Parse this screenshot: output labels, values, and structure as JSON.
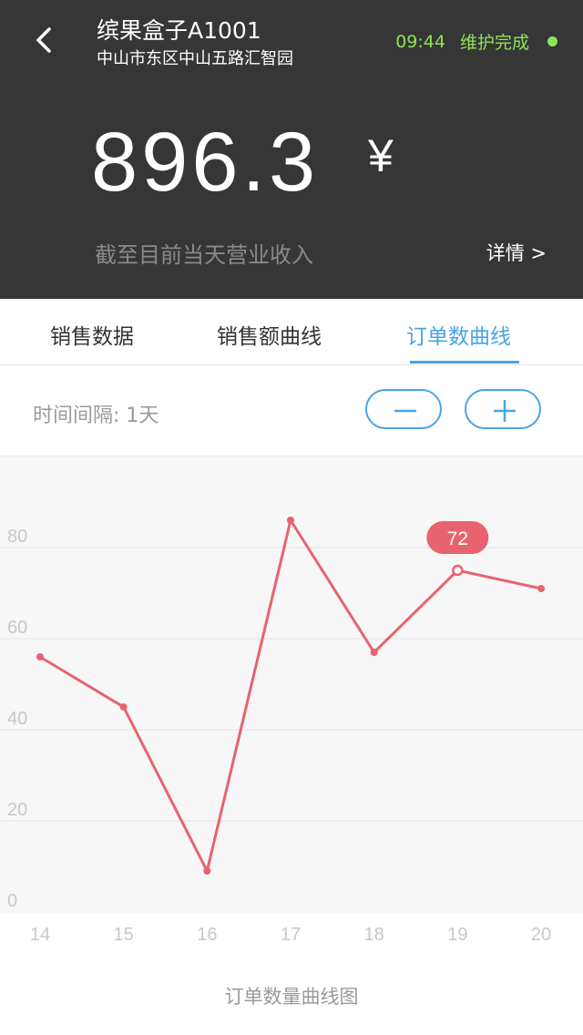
{
  "header": {
    "title": "缤果盒子A1001",
    "address": "中山市东区中山五路汇智园",
    "time": "09:44",
    "status_text": "维护完成",
    "status_color": "#8fe35a",
    "back_icon": "chevron-left-icon"
  },
  "revenue": {
    "amount": "896.3",
    "currency_symbol": "¥",
    "caption": "截至目前当天营业收入",
    "detail_label": "详情 >"
  },
  "tabs": [
    {
      "label": "销售数据",
      "active": false
    },
    {
      "label": "销售额曲线",
      "active": false
    },
    {
      "label": "订单数曲线",
      "active": true
    }
  ],
  "controls": {
    "interval_label": "时间间隔: 1天",
    "decrease_icon": "minus-icon",
    "increase_icon": "plus-icon"
  },
  "chart_data": {
    "type": "line",
    "title": "订单数量曲线图",
    "x": [
      14,
      15,
      16,
      17,
      18,
      19,
      20
    ],
    "series": [
      {
        "values": [
          53,
          42,
          6,
          83,
          54,
          72,
          68
        ],
        "color": "#e8636f"
      }
    ],
    "ylim": [
      0,
      80
    ],
    "yticks": [
      0,
      20,
      40,
      60,
      80
    ],
    "highlight": {
      "index": 5,
      "label": "72"
    },
    "grid": true
  },
  "colors": {
    "header_bg": "#363636",
    "accent": "#48a5e5",
    "line": "#e8636f"
  }
}
